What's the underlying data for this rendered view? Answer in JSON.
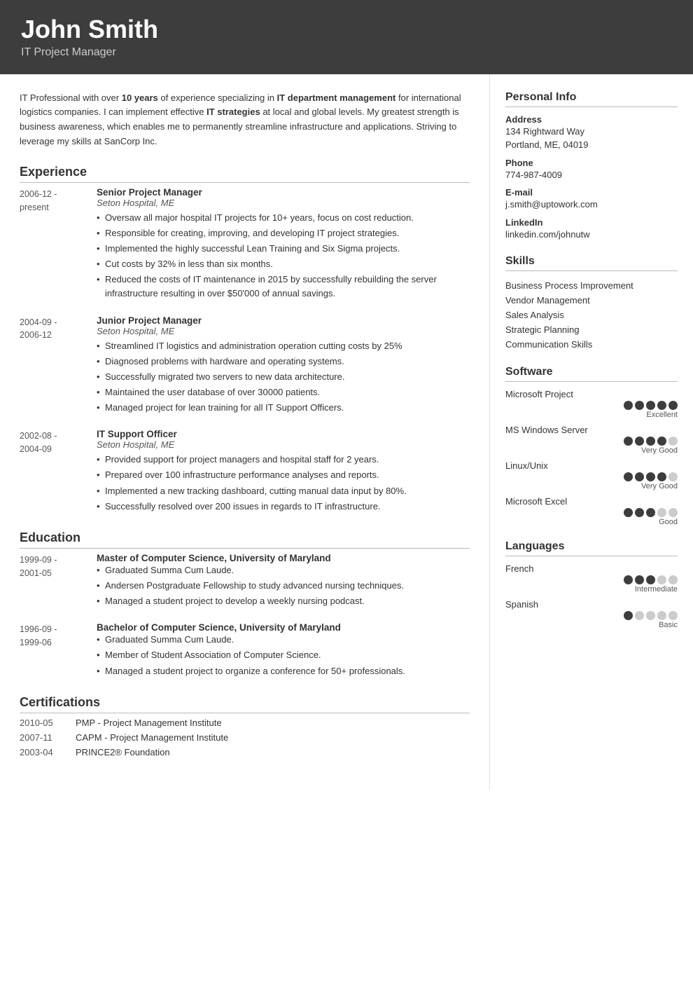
{
  "header": {
    "name": "John Smith",
    "title": "IT Project Manager"
  },
  "summary": {
    "text_parts": [
      {
        "type": "normal",
        "text": "IT Professional with over "
      },
      {
        "type": "bold",
        "text": "10 years"
      },
      {
        "type": "normal",
        "text": " of experience specializing in "
      },
      {
        "type": "bold",
        "text": "IT department management"
      },
      {
        "type": "normal",
        "text": " for international logistics companies. I can implement effective "
      },
      {
        "type": "bold",
        "text": "IT strategies"
      },
      {
        "type": "normal",
        "text": " at local and global levels. My greatest strength is business awareness, which enables me to permanently streamline infrastructure and applications. Striving to leverage my skills at SanCorp Inc."
      }
    ]
  },
  "sections": {
    "experience_label": "Experience",
    "education_label": "Education",
    "certifications_label": "Certifications"
  },
  "experience": [
    {
      "date": "2006-12 -\npresent",
      "title": "Senior Project Manager",
      "subtitle": "Seton Hospital, ME",
      "bullets": [
        "Oversaw all major hospital IT projects for 10+ years, focus on cost reduction.",
        "Responsible for creating, improving, and developing IT project strategies.",
        "Implemented the highly successful Lean Training and Six Sigma projects.",
        "Cut costs by 32% in less than six months.",
        "Reduced the costs of IT maintenance in 2015 by successfully rebuilding the server infrastructure resulting in over $50'000 of annual savings."
      ]
    },
    {
      "date": "2004-09 -\n2006-12",
      "title": "Junior Project Manager",
      "subtitle": "Seton Hospital, ME",
      "bullets": [
        "Streamlined IT logistics and administration operation cutting costs by 25%",
        "Diagnosed problems with hardware and operating systems.",
        "Successfully migrated two servers to new data architecture.",
        "Maintained the user database of over 30000 patients.",
        "Managed project for lean training for all IT Support Officers."
      ]
    },
    {
      "date": "2002-08 -\n2004-09",
      "title": "IT Support Officer",
      "subtitle": "Seton Hospital, ME",
      "bullets": [
        "Provided support for project managers and hospital staff for 2 years.",
        "Prepared over 100 infrastructure performance analyses and reports.",
        "Implemented a new tracking dashboard, cutting manual data input by 80%.",
        "Successfully resolved over 200 issues in regards to IT infrastructure."
      ]
    }
  ],
  "education": [
    {
      "date": "1999-09 -\n2001-05",
      "title": "Master of Computer Science, University of Maryland",
      "subtitle": "",
      "bullets": [
        "Graduated Summa Cum Laude.",
        "Andersen Postgraduate Fellowship to study advanced nursing techniques.",
        "Managed a student project to develop a weekly nursing podcast."
      ]
    },
    {
      "date": "1996-09 -\n1999-06",
      "title": "Bachelor of Computer Science, University of Maryland",
      "subtitle": "",
      "bullets": [
        "Graduated Summa Cum Laude.",
        "Member of Student Association of Computer Science.",
        "Managed a student project to organize a conference for 50+ professionals."
      ]
    }
  ],
  "certifications": [
    {
      "date": "2010-05",
      "name": "PMP - Project Management Institute"
    },
    {
      "date": "2007-11",
      "name": "CAPM - Project Management Institute"
    },
    {
      "date": "2003-04",
      "name": "PRINCE2® Foundation"
    }
  ],
  "personal_info": {
    "section_title": "Personal Info",
    "address_label": "Address",
    "address_value": "134 Rightward Way\nPortland, ME, 04019",
    "phone_label": "Phone",
    "phone_value": "774-987-4009",
    "email_label": "E-mail",
    "email_value": "j.smith@uptowork.com",
    "linkedin_label": "LinkedIn",
    "linkedin_value": "linkedin.com/johnutw"
  },
  "skills": {
    "section_title": "Skills",
    "items": [
      "Business Process Improvement",
      "Vendor Management",
      "Sales Analysis",
      "Strategic Planning",
      "Communication Skills"
    ]
  },
  "software": {
    "section_title": "Software",
    "items": [
      {
        "name": "Microsoft Project",
        "filled": 5,
        "total": 5,
        "label": "Excellent"
      },
      {
        "name": "MS Windows Server",
        "filled": 4,
        "total": 5,
        "label": "Very Good"
      },
      {
        "name": "Linux/Unix",
        "filled": 4,
        "total": 5,
        "label": "Very Good"
      },
      {
        "name": "Microsoft Excel",
        "filled": 3,
        "total": 5,
        "label": "Good"
      }
    ]
  },
  "languages": {
    "section_title": "Languages",
    "items": [
      {
        "name": "French",
        "filled": 3,
        "total": 5,
        "label": "Intermediate"
      },
      {
        "name": "Spanish",
        "filled": 1,
        "total": 5,
        "label": "Basic"
      }
    ]
  }
}
